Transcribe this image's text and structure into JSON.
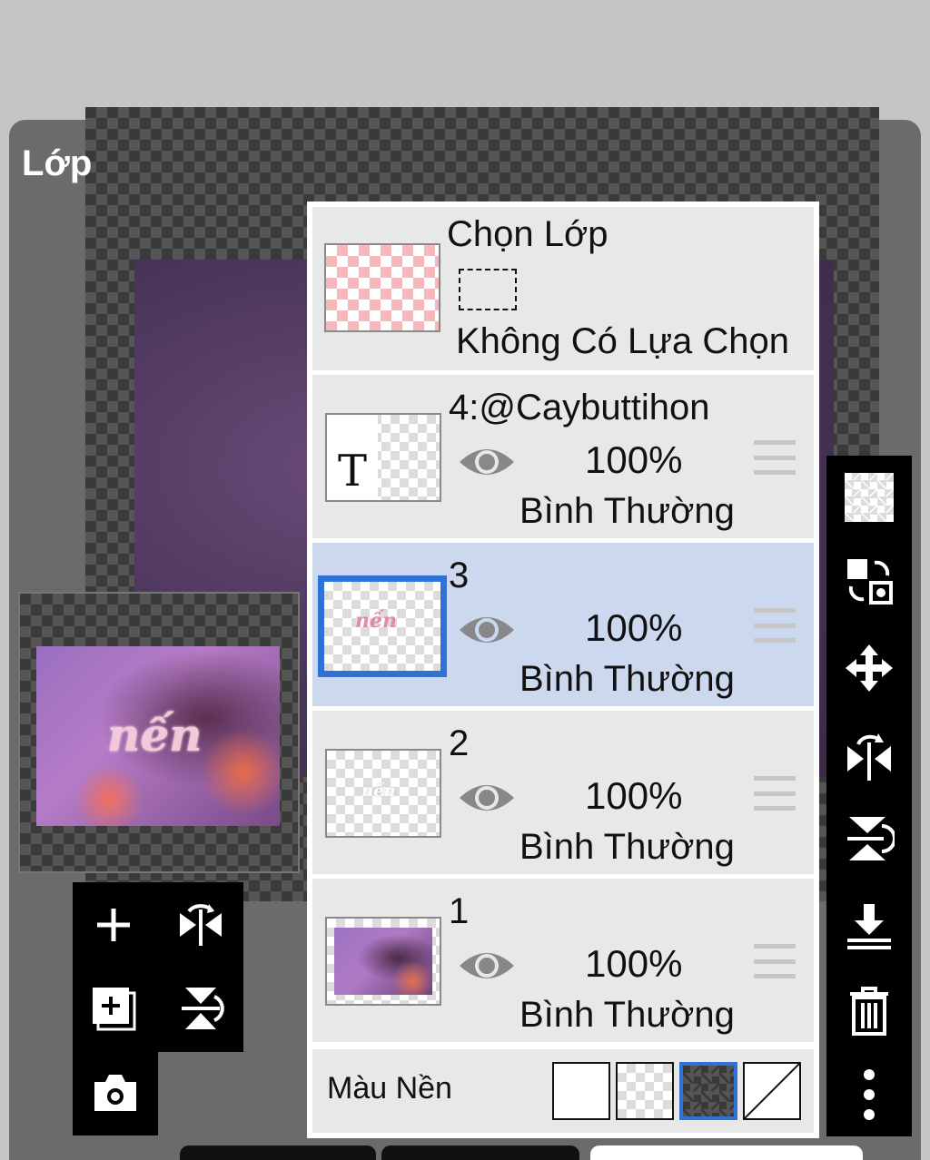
{
  "panel": {
    "title": "Lớp"
  },
  "selection": {
    "title": "Chọn Lớp",
    "status": "Không Có Lựa Chọn"
  },
  "layers": [
    {
      "name": "4:@Caybuttihon",
      "opacity": "100%",
      "blend": "Bình Thường",
      "visible": true,
      "active": false,
      "thumb": "text-layer",
      "thumb_letter": "T"
    },
    {
      "name": "3",
      "opacity": "100%",
      "blend": "Bình Thường",
      "visible": true,
      "active": true,
      "thumb": "pink-text"
    },
    {
      "name": "2",
      "opacity": "100%",
      "blend": "Bình Thường",
      "visible": true,
      "active": false,
      "thumb": "white-text"
    },
    {
      "name": "1",
      "opacity": "100%",
      "blend": "Bình Thường",
      "visible": true,
      "active": false,
      "thumb": "photo"
    }
  ],
  "background": {
    "label": "Màu Nền",
    "options": [
      "white",
      "checker-light",
      "checker-dark",
      "none"
    ],
    "selected": "checker-dark"
  },
  "preview": {
    "word": "nến"
  },
  "toolbar_left": [
    "add-layer-icon",
    "flip-horizontal-icon",
    "add-canvas-layer-icon",
    "flip-vertical-icon",
    "camera-icon"
  ],
  "toolbar_right": [
    "transparency-icon",
    "swap-layer-icon",
    "move-icon",
    "flip-horizontal-icon",
    "flip-vertical-icon",
    "merge-down-icon",
    "trash-icon",
    "more-icon"
  ],
  "colors": {
    "accent": "#2d72d6",
    "active_row": "#cbd8ee",
    "row": "#e8e8e8",
    "panel": "#6b6b6b"
  }
}
